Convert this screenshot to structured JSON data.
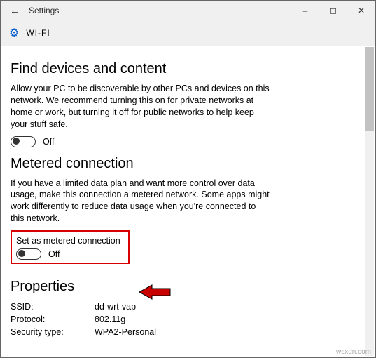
{
  "window": {
    "app_title": "Settings",
    "page_title": "WI-FI"
  },
  "sections": {
    "find": {
      "heading": "Find devices and content",
      "desc": "Allow your PC to be discoverable by other PCs and devices on this network. We recommend turning this on for private networks at home or work, but turning it off for public networks to help keep your stuff safe.",
      "toggle_state": "Off"
    },
    "metered": {
      "heading": "Metered connection",
      "desc": "If you have a limited data plan and want more control over data usage, make this connection a metered network. Some apps might work differently to reduce data usage when you're connected to this network.",
      "set_label": "Set as metered connection",
      "toggle_state": "Off"
    },
    "properties": {
      "heading": "Properties",
      "rows": [
        {
          "label": "SSID:",
          "value": "dd-wrt-vap"
        },
        {
          "label": "Protocol:",
          "value": "802.11g"
        },
        {
          "label": "Security type:",
          "value": "WPA2-Personal"
        }
      ]
    }
  },
  "watermark": "wsxdn.com"
}
